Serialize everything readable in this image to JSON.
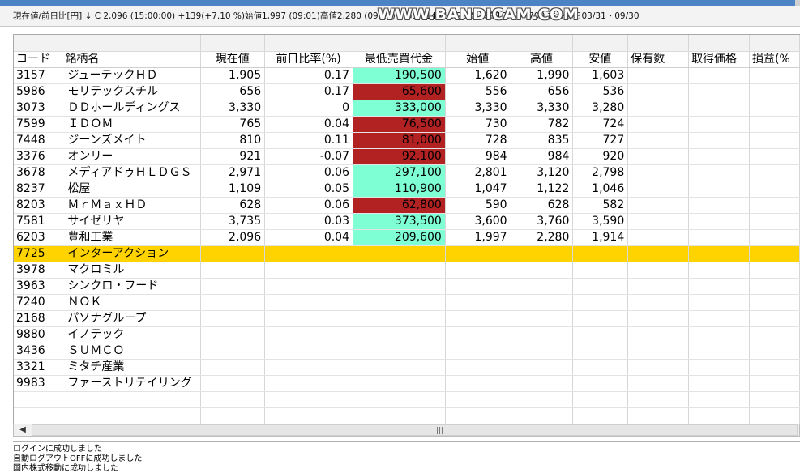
{
  "infobar": {
    "text": "現在値/前日比[円] ↓ C 2,096 (15:00:00) +139(+7.10 %)始値1,997 (09:01)高値2,280 (09:14)安値1,914 (11:25)出来高10,474,700 株決算日03/31・09/30"
  },
  "watermark": "WWW.BANDICAM.COM",
  "grid": {
    "columns": [
      "コード",
      "銘柄名",
      "現在値",
      "前日比率(%)",
      "最低売買代金",
      "始値",
      "高値",
      "安値",
      "保有数",
      "取得価格",
      "損益(%"
    ],
    "rows": [
      {
        "code": "3157",
        "name": "ジューテックＨＤ",
        "price": "1,905",
        "change": "0.17",
        "min": "190,500",
        "hl": "green",
        "open": "1,620",
        "high": "1,990",
        "low": "1,603"
      },
      {
        "code": "5986",
        "name": "モリテックスチル",
        "price": "656",
        "change": "0.17",
        "min": "65,600",
        "hl": "red",
        "open": "556",
        "high": "656",
        "low": "536"
      },
      {
        "code": "3073",
        "name": "ＤＤホールディングス",
        "price": "3,330",
        "change": "0",
        "min": "333,000",
        "hl": "green",
        "open": "3,330",
        "high": "3,330",
        "low": "3,280"
      },
      {
        "code": "7599",
        "name": "ＩＤＯＭ",
        "price": "765",
        "change": "0.04",
        "min": "76,500",
        "hl": "red",
        "open": "730",
        "high": "782",
        "low": "724"
      },
      {
        "code": "7448",
        "name": "ジーンズメイト",
        "price": "810",
        "change": "0.11",
        "min": "81,000",
        "hl": "red",
        "open": "728",
        "high": "835",
        "low": "727"
      },
      {
        "code": "3376",
        "name": "オンリー",
        "price": "921",
        "change": "-0.07",
        "min": "92,100",
        "hl": "red",
        "open": "984",
        "high": "984",
        "low": "920"
      },
      {
        "code": "3678",
        "name": "メディアドゥＨＬＤＧＳ",
        "price": "2,971",
        "change": "0.06",
        "min": "297,100",
        "hl": "green",
        "open": "2,801",
        "high": "3,120",
        "low": "2,798"
      },
      {
        "code": "8237",
        "name": "松屋",
        "price": "1,109",
        "change": "0.05",
        "min": "110,900",
        "hl": "green",
        "open": "1,047",
        "high": "1,122",
        "low": "1,046"
      },
      {
        "code": "8203",
        "name": "ＭｒＭａｘＨＤ",
        "price": "628",
        "change": "0.06",
        "min": "62,800",
        "hl": "red",
        "open": "590",
        "high": "628",
        "low": "582"
      },
      {
        "code": "7581",
        "name": "サイゼリヤ",
        "price": "3,735",
        "change": "0.03",
        "min": "373,500",
        "hl": "green",
        "open": "3,600",
        "high": "3,760",
        "low": "3,590"
      },
      {
        "code": "6203",
        "name": "豊和工業",
        "price": "2,096",
        "change": "0.04",
        "min": "209,600",
        "hl": "green",
        "open": "1,997",
        "high": "2,280",
        "low": "1,914"
      },
      {
        "code": "7725",
        "name": "インターアクション",
        "price": "",
        "change": "",
        "min": "",
        "hl": "",
        "open": "",
        "high": "",
        "low": "",
        "selected": true
      },
      {
        "code": "3978",
        "name": "マクロミル",
        "price": "",
        "change": "",
        "min": "",
        "hl": "",
        "open": "",
        "high": "",
        "low": ""
      },
      {
        "code": "3963",
        "name": "シンクロ・フード",
        "price": "",
        "change": "",
        "min": "",
        "hl": "",
        "open": "",
        "high": "",
        "low": ""
      },
      {
        "code": "7240",
        "name": "ＮＯＫ",
        "price": "",
        "change": "",
        "min": "",
        "hl": "",
        "open": "",
        "high": "",
        "low": ""
      },
      {
        "code": "2168",
        "name": "パソナグループ",
        "price": "",
        "change": "",
        "min": "",
        "hl": "",
        "open": "",
        "high": "",
        "low": ""
      },
      {
        "code": "9880",
        "name": "イノテック",
        "price": "",
        "change": "",
        "min": "",
        "hl": "",
        "open": "",
        "high": "",
        "low": ""
      },
      {
        "code": "3436",
        "name": "ＳＵＭＣＯ",
        "price": "",
        "change": "",
        "min": "",
        "hl": "",
        "open": "",
        "high": "",
        "low": ""
      },
      {
        "code": "3321",
        "name": "ミタチ産業",
        "price": "",
        "change": "",
        "min": "",
        "hl": "",
        "open": "",
        "high": "",
        "low": ""
      },
      {
        "code": "9983",
        "name": "ファーストリテイリング",
        "price": "",
        "change": "",
        "min": "",
        "hl": "",
        "open": "",
        "high": "",
        "low": ""
      }
    ]
  },
  "scrollbar": {
    "left_arrow": "◀",
    "grip": "|||"
  },
  "log": [
    "ログインに成功しました",
    "自動ログアウトOFFに成功しました",
    "国内株式移動に成功しました"
  ],
  "colors": {
    "green_cell": "#7fffd4",
    "red_cell": "#b22222",
    "selected_row": "#ffd300"
  }
}
